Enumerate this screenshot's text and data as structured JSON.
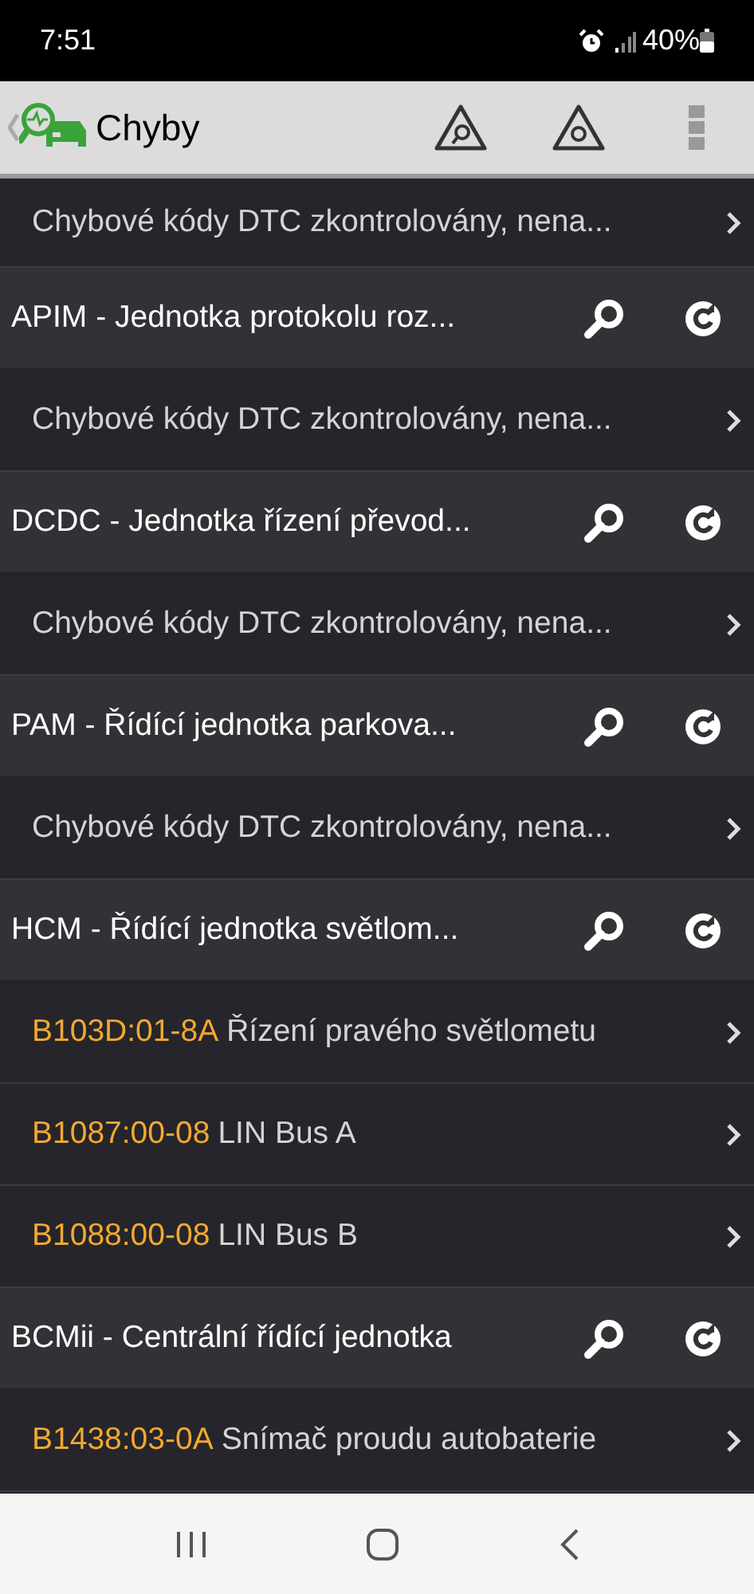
{
  "status_bar": {
    "time": "7:51",
    "battery": "40%"
  },
  "header": {
    "title": "Chyby"
  },
  "rows": [
    {
      "kind": "info",
      "text": "Chybové kódy DTC zkontrolovány, nena..."
    },
    {
      "kind": "module",
      "text": "APIM - Jednotka protokolu roz..."
    },
    {
      "kind": "info",
      "text": "Chybové kódy DTC zkontrolovány, nena..."
    },
    {
      "kind": "module",
      "text": "DCDC - Jednotka řízení převod..."
    },
    {
      "kind": "info",
      "text": "Chybové kódy DTC zkontrolovány, nena..."
    },
    {
      "kind": "module",
      "text": "PAM - Řídící jednotka parkova..."
    },
    {
      "kind": "info",
      "text": "Chybové kódy DTC zkontrolovány, nena..."
    },
    {
      "kind": "module",
      "text": "HCM - Řídící jednotka světlom..."
    },
    {
      "kind": "dtc",
      "code": "B103D:01-8A",
      "text": "Řízení pravého světlometu"
    },
    {
      "kind": "dtc",
      "code": "B1087:00-08",
      "text": "LIN Bus A"
    },
    {
      "kind": "dtc",
      "code": "B1088:00-08",
      "text": "LIN Bus B"
    },
    {
      "kind": "module",
      "text": "BCMii - Centrální řídící jednotka"
    },
    {
      "kind": "dtc",
      "code": "B1438:03-0A",
      "text": "Snímač proudu autobaterie"
    }
  ]
}
